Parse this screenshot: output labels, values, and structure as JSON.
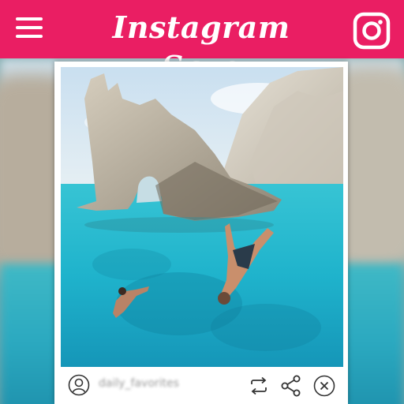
{
  "header": {
    "title": "Instagram Save",
    "menu_icon": "hamburger-menu-icon",
    "brand_icon": "instagram-icon",
    "background_color": "#ea1e63",
    "foreground_color": "#ffffff"
  },
  "post": {
    "image_icon": "photo",
    "username": "daily_favorites",
    "actions": {
      "profile_icon": "user-icon",
      "repost_icon": "repost-icon",
      "share_icon": "share-icon",
      "close_icon": "close-icon"
    }
  }
}
